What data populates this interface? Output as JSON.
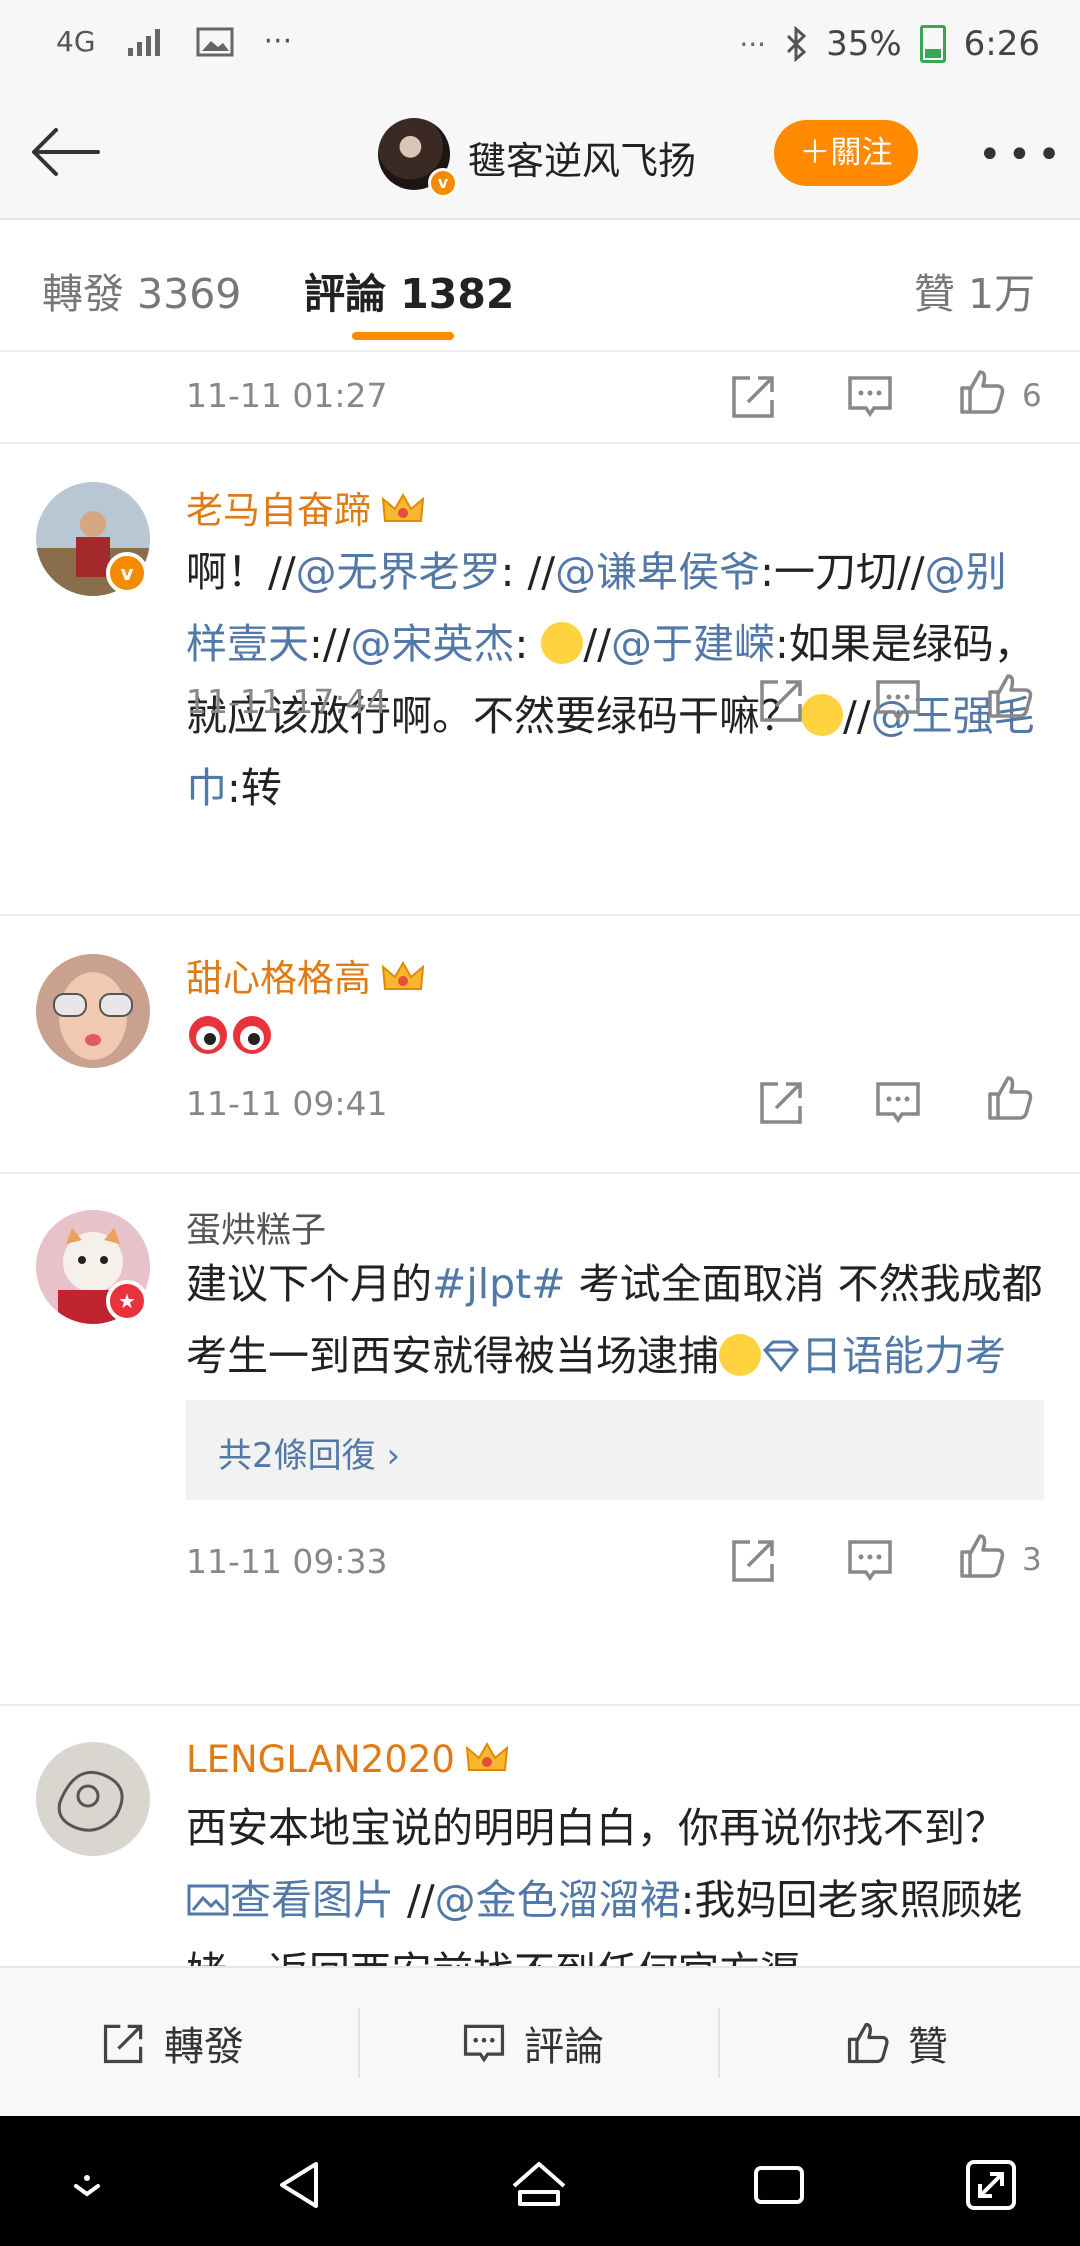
{
  "status": {
    "network": "4G",
    "time": "6:26",
    "battery": "35%",
    "more": "···"
  },
  "header": {
    "name": "毽客逆风飞扬",
    "follow": "＋關注",
    "more": "•••"
  },
  "tabs": {
    "repost": "轉發 3369",
    "comment": "評論 1382",
    "like": "贊 1万"
  },
  "comments": [
    {
      "time": "11-11 01:27",
      "likes": "6"
    },
    {
      "name": "老马自奋蹄",
      "p1": "啊！//",
      "m1": "@无界老罗",
      "p2": ": //",
      "m2": "@谦卑侯爷",
      "p3": ":一刀切//",
      "m3": "@别样壹天",
      "p4": "://",
      "m4": "@宋英杰",
      "p5": ": ",
      "p6": "//",
      "m5": "@于建嵘",
      "p7": ":如果是绿码，就应该放行啊。不然要绿码干嘛？",
      "p8": "//",
      "m6": "@王强毛巾",
      "p9": ":转",
      "time": "11-11 17:44"
    },
    {
      "name": "甜心格格高",
      "time": "11-11 09:41"
    },
    {
      "name": "蛋烘糕子",
      "p1": "建议下个月的",
      "tag": "#jlpt#",
      "p2": " 考试全面取消 不然我成都考生一到西安就得被当场逮捕",
      "topic": "日语能力考试JLPT超话",
      "replies": "共2條回復 ›",
      "time": "11-11 09:33",
      "likes": "3"
    },
    {
      "name": "LENGLAN2020",
      "p1": "西安本地宝说的明明白白，你再说你找不到？ ",
      "img": "查看图片",
      "p2": "  //",
      "m1": "@金色溜溜裙",
      "p3": ":我妈回老家照顾姥姥，返回西安前找不到任何官方渠"
    }
  ],
  "bottom": {
    "repost": "轉發",
    "comment": "評論",
    "like": "贊"
  }
}
